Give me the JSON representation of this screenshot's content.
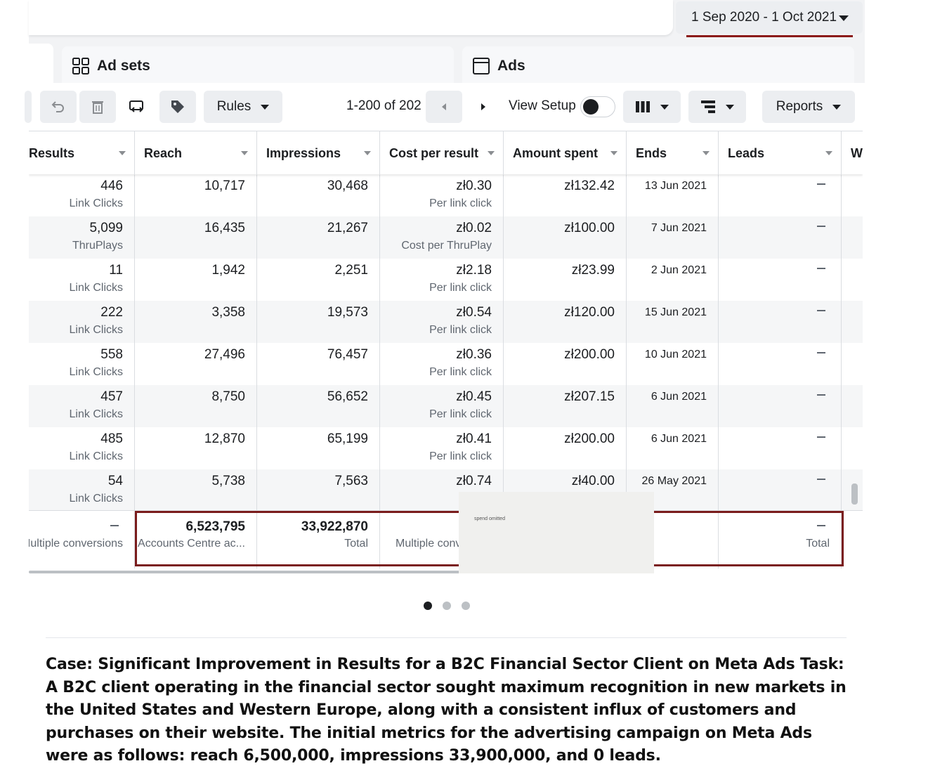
{
  "header": {
    "date_range": "1 Sep 2020 - 1 Oct 2021"
  },
  "tabs": [
    {
      "label": "Ad sets",
      "icon": "grid-icon"
    },
    {
      "label": "Ads",
      "icon": "ad-window-icon"
    }
  ],
  "toolbar": {
    "rules_label": "Rules",
    "pagination": "1-200 of 202",
    "view_setup_label": "View Setup",
    "view_setup_on": false,
    "reports_label": "Reports",
    "icons": [
      "undo-icon",
      "trash-icon",
      "duplicate-edit-icon",
      "tag-icon",
      "prev-page-icon",
      "next-page-icon",
      "columns-icon",
      "breakdown-icon"
    ]
  },
  "table": {
    "columns": [
      "Results",
      "Reach",
      "Impressions",
      "Cost per result",
      "Amount spent",
      "Ends",
      "Leads",
      "W"
    ],
    "rows": [
      {
        "results": "446",
        "results_type": "Link Clicks",
        "reach": "10,717",
        "impressions": "30,468",
        "cost": "zł0.30",
        "cost_type": "Per link click",
        "spent": "zł132.42",
        "ends": "13 Jun 2021",
        "leads": "—"
      },
      {
        "results": "5,099",
        "results_type": "ThruPlays",
        "reach": "16,435",
        "impressions": "21,267",
        "cost": "zł0.02",
        "cost_type": "Cost per ThruPlay",
        "spent": "zł100.00",
        "ends": "7 Jun 2021",
        "leads": "—"
      },
      {
        "results": "11",
        "results_type": "Link Clicks",
        "reach": "1,942",
        "impressions": "2,251",
        "cost": "zł2.18",
        "cost_type": "Per link click",
        "spent": "zł23.99",
        "ends": "2 Jun 2021",
        "leads": "—"
      },
      {
        "results": "222",
        "results_type": "Link Clicks",
        "reach": "3,358",
        "impressions": "19,573",
        "cost": "zł0.54",
        "cost_type": "Per link click",
        "spent": "zł120.00",
        "ends": "15 Jun 2021",
        "leads": "—"
      },
      {
        "results": "558",
        "results_type": "Link Clicks",
        "reach": "27,496",
        "impressions": "76,457",
        "cost": "zł0.36",
        "cost_type": "Per link click",
        "spent": "zł200.00",
        "ends": "10 Jun 2021",
        "leads": "—"
      },
      {
        "results": "457",
        "results_type": "Link Clicks",
        "reach": "8,750",
        "impressions": "56,652",
        "cost": "zł0.45",
        "cost_type": "Per link click",
        "spent": "zł207.15",
        "ends": "6 Jun 2021",
        "leads": "—"
      },
      {
        "results": "485",
        "results_type": "Link Clicks",
        "reach": "12,870",
        "impressions": "65,199",
        "cost": "zł0.41",
        "cost_type": "Per link click",
        "spent": "zł200.00",
        "ends": "6 Jun 2021",
        "leads": "—"
      },
      {
        "results": "54",
        "results_type": "Link Clicks",
        "reach": "5,738",
        "impressions": "7,563",
        "cost": "zł0.74",
        "cost_type": "Per lir",
        "spent": "zł40.00",
        "ends": "26 May 2021",
        "leads": "—"
      }
    ],
    "totals": {
      "results": "—",
      "results_sub": "Multiple conversions",
      "reach": "6,523,795",
      "reach_sub": "Accounts Centre ac...",
      "impressions": "33,922,870",
      "impressions_sub": "Total",
      "cost_sub": "Multiple conv",
      "leads": "—",
      "leads_sub": "Total"
    }
  },
  "overlay_note": "spend omitted",
  "carousel": {
    "count": 3,
    "active": 0
  },
  "caption": "Case: Significant Improvement in Results for a B2C Financial Sector Client on Meta Ads Task: A B2C client operating in the financial sector sought maximum recognition in new markets in the United States and Western Europe, along with a consistent influx of customers and purchases on their website. The initial metrics for the advertising campaign on Meta Ads were as follows: reach 6,500,000, impressions 33,900,000, and 0 leads.",
  "colors": {
    "highlight_border": "#7a1c1c",
    "row_alt": "#f5f6f7",
    "button_bg": "#eceef1"
  }
}
